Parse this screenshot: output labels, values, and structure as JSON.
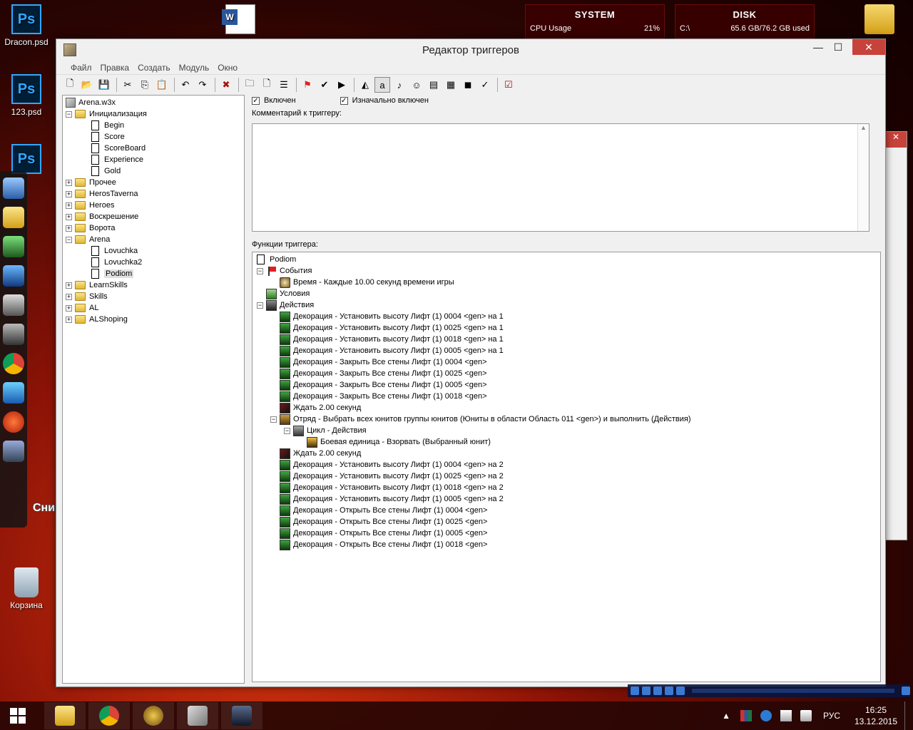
{
  "desktop": {
    "icons": [
      {
        "label": "Dracon.psd",
        "type": "photoshop"
      },
      {
        "label": "123.psd",
        "type": "photoshop"
      },
      {
        "label": "Корзина",
        "type": "recycle-bin"
      }
    ],
    "gadgets": {
      "system": {
        "title": "SYSTEM",
        "metric_label": "CPU Usage",
        "metric_value": "21%"
      },
      "disk": {
        "title": "DISK",
        "drive": "C:\\",
        "usage": "65.6 GB/76.2 GB used"
      }
    },
    "dock_label": "Снимок экрана"
  },
  "window": {
    "title": "Редактор триггеров",
    "menu": [
      "Файл",
      "Правка",
      "Создать",
      "Модуль",
      "Окно"
    ]
  },
  "toolbar": {
    "buttons": [
      "new-icon",
      "open-icon",
      "save-icon",
      "sep",
      "cut-icon",
      "copy-icon",
      "paste-icon",
      "sep",
      "undo-icon",
      "redo-icon",
      "sep",
      "delete-icon",
      "sep",
      "new-category-icon",
      "new-trigger-icon",
      "new-comment-icon",
      "sep",
      "new-event-icon",
      "new-condition-icon",
      "new-action-icon",
      "sep",
      "terrain-icon",
      "object-icon",
      "sound-icon",
      "ai-icon",
      "campaign-icon",
      "import-icon",
      "test-map-icon",
      "validate-icon",
      "sep",
      "test-icon"
    ]
  },
  "tree": {
    "root": "Arena.w3x",
    "items": [
      {
        "label": "Инициализация",
        "kind": "folder",
        "expanded": true,
        "depth": 0
      },
      {
        "label": "Begin",
        "kind": "trigger",
        "depth": 1
      },
      {
        "label": "Score",
        "kind": "trigger",
        "depth": 1
      },
      {
        "label": "ScoreBoard",
        "kind": "trigger",
        "depth": 1
      },
      {
        "label": "Experience",
        "kind": "trigger",
        "depth": 1
      },
      {
        "label": "Gold",
        "kind": "trigger",
        "depth": 1
      },
      {
        "label": "Прочее",
        "kind": "folder",
        "expanded": false,
        "depth": 0
      },
      {
        "label": "HerosTaverna",
        "kind": "folder",
        "expanded": false,
        "depth": 0
      },
      {
        "label": "Heroes",
        "kind": "folder",
        "expanded": false,
        "depth": 0
      },
      {
        "label": "Воскрешение",
        "kind": "folder",
        "expanded": false,
        "depth": 0
      },
      {
        "label": "Ворота",
        "kind": "folder",
        "expanded": false,
        "depth": 0
      },
      {
        "label": "Arena",
        "kind": "folder",
        "expanded": true,
        "depth": 0
      },
      {
        "label": "Lovuchka",
        "kind": "trigger",
        "depth": 1
      },
      {
        "label": "Lovuchka2",
        "kind": "trigger",
        "depth": 1
      },
      {
        "label": "Podiom",
        "kind": "trigger",
        "depth": 1,
        "selected": true
      },
      {
        "label": "LearnSkills",
        "kind": "folder",
        "expanded": false,
        "depth": 0
      },
      {
        "label": "Skills",
        "kind": "folder",
        "expanded": false,
        "depth": 0
      },
      {
        "label": "AL",
        "kind": "folder",
        "expanded": false,
        "depth": 0
      },
      {
        "label": "ALShoping",
        "kind": "folder",
        "expanded": false,
        "depth": 0
      }
    ]
  },
  "trigger": {
    "enabled_label": "Включен",
    "enabled": true,
    "initially_on_label": "Изначально включен",
    "initially_on": true,
    "comment_label": "Комментарий к триггеру:",
    "comment": "",
    "functions_label": "Функции триггера:",
    "name": "Podiom",
    "functions": [
      {
        "text": "События",
        "icon": "flag",
        "depth": 0,
        "expander": "-"
      },
      {
        "text": "Время - Каждые 10.00 секунд времени игры",
        "icon": "time",
        "depth": 1
      },
      {
        "text": "Условия",
        "icon": "cond",
        "depth": 0
      },
      {
        "text": "Действия",
        "icon": "act",
        "depth": 0,
        "expander": "-"
      },
      {
        "text": "Декорация - Установить высоту Лифт (1) 0004 <gen> на 1",
        "icon": "deco",
        "depth": 1
      },
      {
        "text": "Декорация - Установить высоту Лифт (1) 0025 <gen> на 1",
        "icon": "deco",
        "depth": 1
      },
      {
        "text": "Декорация - Установить высоту Лифт (1) 0018 <gen> на 1",
        "icon": "deco",
        "depth": 1
      },
      {
        "text": "Декорация - Установить высоту Лифт (1) 0005 <gen> на 1",
        "icon": "deco",
        "depth": 1
      },
      {
        "text": "Декорация - Закрыть Все стены Лифт (1) 0004 <gen>",
        "icon": "deco",
        "depth": 1
      },
      {
        "text": "Декорация - Закрыть Все стены Лифт (1) 0025 <gen>",
        "icon": "deco",
        "depth": 1
      },
      {
        "text": "Декорация - Закрыть Все стены Лифт (1) 0005 <gen>",
        "icon": "deco",
        "depth": 1
      },
      {
        "text": "Декорация - Закрыть Все стены Лифт (1) 0018 <gen>",
        "icon": "deco",
        "depth": 1
      },
      {
        "text": "Ждать 2.00 секунд",
        "icon": "wait",
        "depth": 1
      },
      {
        "text": "Отряд - Выбрать всех юнитов группы юнитов (Юниты в области Область 011 <gen>) и выполнить (Действия)",
        "icon": "group",
        "depth": 1,
        "expander": "-"
      },
      {
        "text": "Цикл - Действия",
        "icon": "loop",
        "depth": 2,
        "expander": "-"
      },
      {
        "text": "Боевая единица - Взорвать (Выбранный юнит)",
        "icon": "unit",
        "depth": 3
      },
      {
        "text": "Ждать 2.00 секунд",
        "icon": "wait",
        "depth": 1
      },
      {
        "text": "Декорация - Установить высоту Лифт (1) 0004 <gen> на 2",
        "icon": "deco",
        "depth": 1
      },
      {
        "text": "Декорация - Установить высоту Лифт (1) 0025 <gen> на 2",
        "icon": "deco",
        "depth": 1
      },
      {
        "text": "Декорация - Установить высоту Лифт (1) 0018 <gen> на 2",
        "icon": "deco",
        "depth": 1
      },
      {
        "text": "Декорация - Установить высоту Лифт (1) 0005 <gen> на 2",
        "icon": "deco",
        "depth": 1
      },
      {
        "text": "Декорация - Открыть Все стены Лифт (1) 0004 <gen>",
        "icon": "deco",
        "depth": 1
      },
      {
        "text": "Декорация - Открыть Все стены Лифт (1) 0025 <gen>",
        "icon": "deco",
        "depth": 1
      },
      {
        "text": "Декорация - Открыть Все стены Лифт (1) 0005 <gen>",
        "icon": "deco",
        "depth": 1
      },
      {
        "text": "Декорация - Открыть Все стены Лифт (1) 0018 <gen>",
        "icon": "deco",
        "depth": 1
      }
    ]
  },
  "taskbar": {
    "apps": [
      "explorer",
      "chrome",
      "warcraft",
      "world-editor",
      "warcraft-frozen-throne"
    ],
    "language": "РУС",
    "time": "16:25",
    "date": "13.12.2015"
  },
  "colors": {
    "close_button": "#c7423a",
    "desktop_accent": "#e03a10"
  }
}
